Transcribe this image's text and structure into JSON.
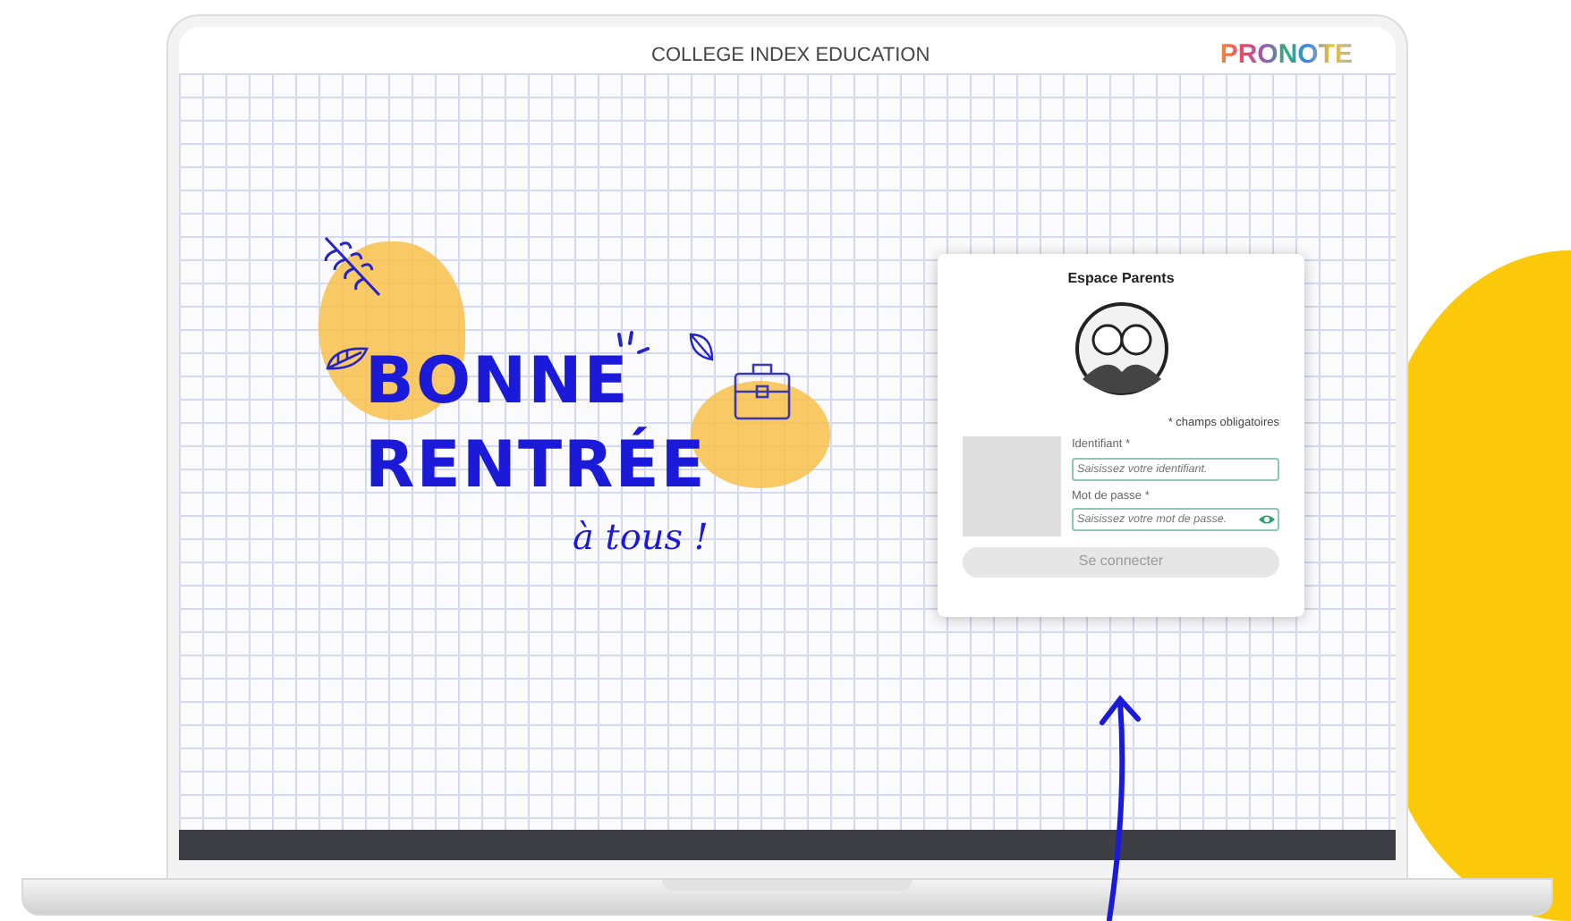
{
  "window": {
    "title": "COLLEGE INDEX EDUCATION",
    "logo": "PRONOTE"
  },
  "banner": {
    "line_1": "BONNE",
    "line_2": "RENTRÉE",
    "line_3": "à tous !"
  },
  "login": {
    "title": "Espace Parents",
    "required_note": "* champs obligatoires",
    "fields": [
      {
        "label": "Identifiant *",
        "placeholder": "Saisissez votre identifiant.",
        "kind": "text"
      },
      {
        "label": "Mot de passe *",
        "placeholder": "Saisissez votre mot de passe.",
        "kind": "password"
      }
    ],
    "button": {
      "label": "Se connecter",
      "disabled": true
    }
  }
}
